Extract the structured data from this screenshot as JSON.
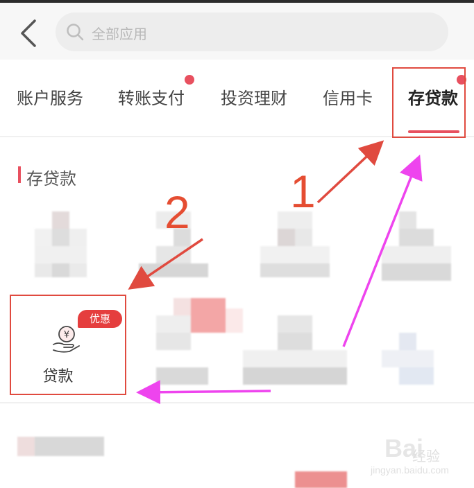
{
  "search": {
    "placeholder": "全部应用"
  },
  "tabs": [
    {
      "label": "账户服务",
      "active": false,
      "dot": false
    },
    {
      "label": "转账支付",
      "active": false,
      "dot": true
    },
    {
      "label": "投资理财",
      "active": false,
      "dot": false
    },
    {
      "label": "信用卡",
      "active": false,
      "dot": false
    },
    {
      "label": "存贷款",
      "active": true,
      "dot": true
    }
  ],
  "section": {
    "title": "存贷款"
  },
  "loan": {
    "label": "贷款",
    "badge": "优惠"
  },
  "annotations": {
    "step1": "1",
    "step2": "2"
  },
  "watermark": {
    "logo": "Bai",
    "text": "经验",
    "url": "jingyan.baidu.com"
  },
  "colors": {
    "accent": "#e8505f",
    "annotation_red": "#e04a3f",
    "arrow_magenta": "#ee44ee"
  }
}
